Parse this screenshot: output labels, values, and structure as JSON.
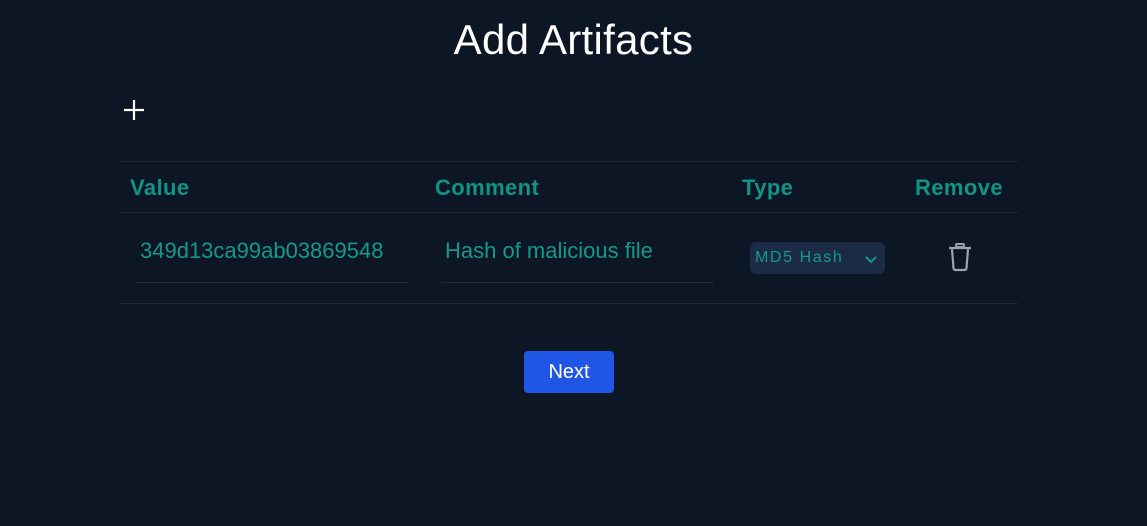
{
  "page": {
    "title": "Add Artifacts"
  },
  "toolbar": {
    "add_icon": "plus-icon"
  },
  "table": {
    "headers": [
      "Value",
      "Comment",
      "Type",
      "Remove"
    ],
    "rows": [
      {
        "value": "349d13ca99ab03869548",
        "comment": "Hash of malicious file",
        "type": "MD5 Hash",
        "remove_icon": "trash-icon"
      }
    ]
  },
  "actions": {
    "next_label": "Next"
  },
  "colors": {
    "background": "#0d1625",
    "accent_teal": "#119485",
    "primary_button": "#2056e6",
    "select_bg": "#1b2b46"
  }
}
